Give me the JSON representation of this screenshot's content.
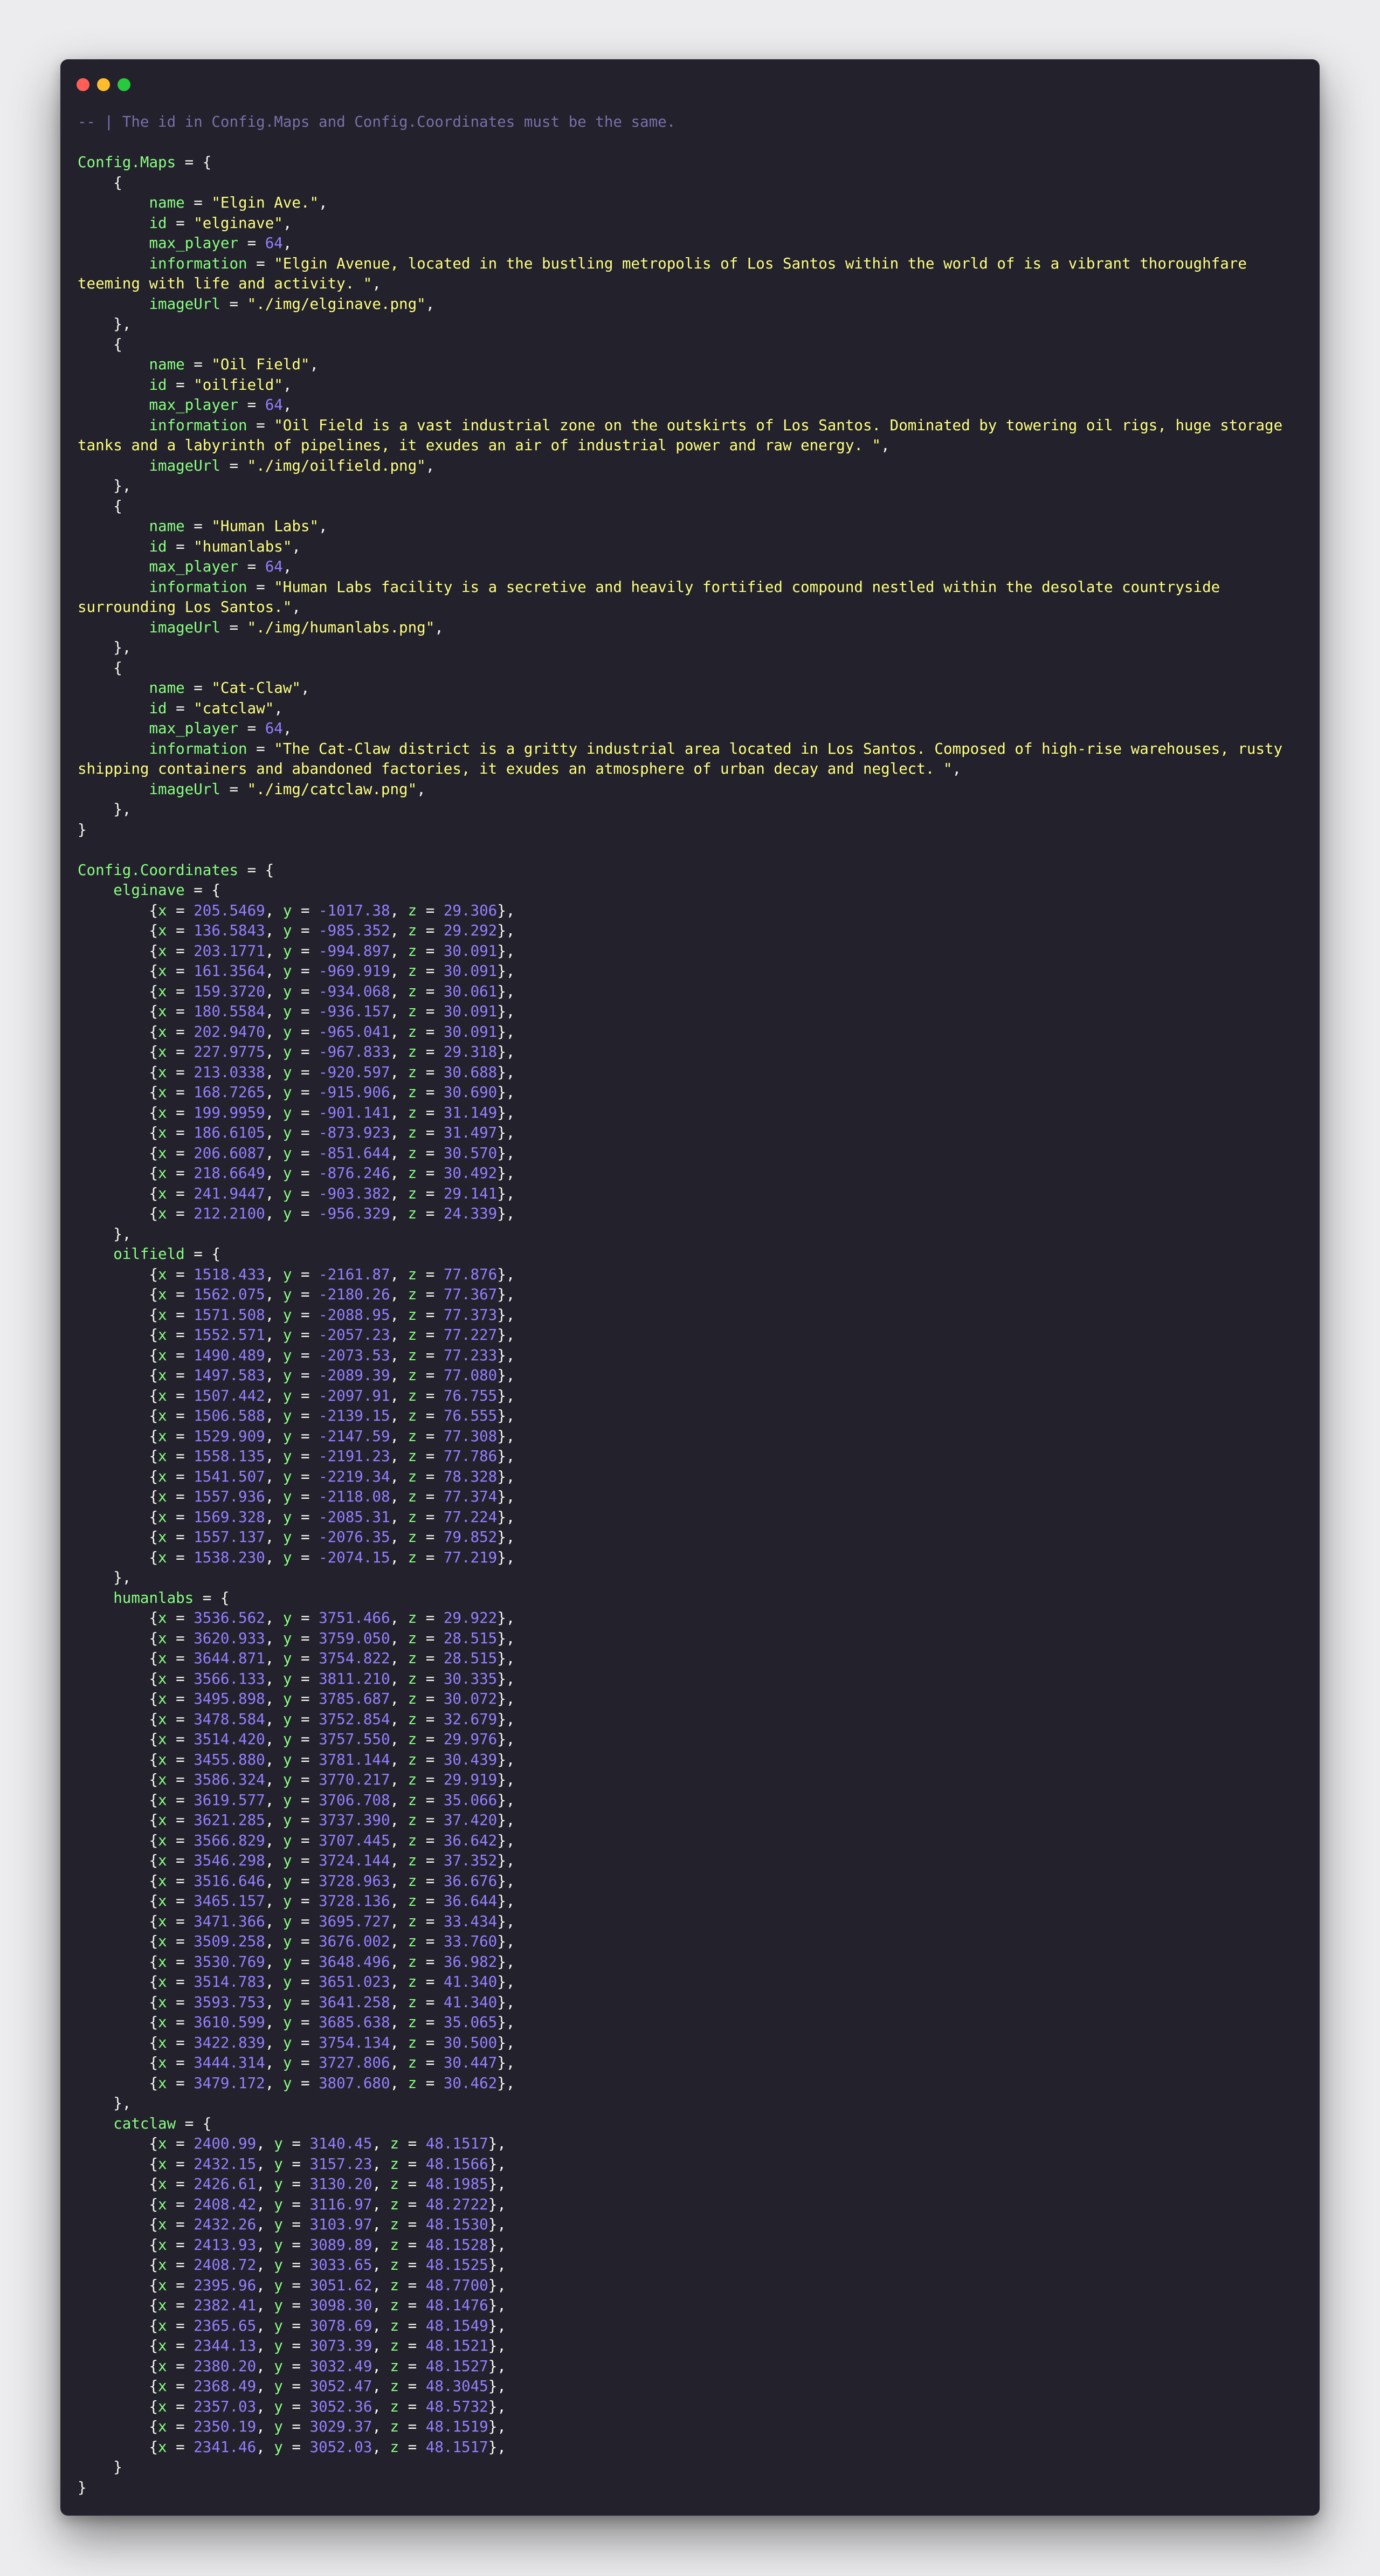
{
  "window": {
    "controls": {
      "close_color": "#ff5f56",
      "minimize_color": "#ffbd2e",
      "maximize_color": "#27c93f"
    }
  },
  "theme": {
    "background": "#22212c",
    "text": "#f8f8f2",
    "comment": "#7970a9",
    "identifier": "#8aff80",
    "string": "#ffff80",
    "number": "#9580ff"
  },
  "code": {
    "comment": "-- | The id in Config.Maps and Config.Coordinates must be the same.",
    "maps_var": "Config.Maps",
    "coords_var": "Config.Coordinates",
    "maps": [
      {
        "name": "\"Elgin Ave.\"",
        "id": "\"elginave\"",
        "max_player": "64",
        "information": "\"Elgin Avenue, located in the bustling metropolis of Los Santos within the world of is a vibrant thoroughfare teeming with life and activity. \"",
        "imageUrl": "\"./img/elginave.png\""
      },
      {
        "name": "\"Oil Field\"",
        "id": "\"oilfield\"",
        "max_player": "64",
        "information": "\"Oil Field is a vast industrial zone on the outskirts of Los Santos. Dominated by towering oil rigs, huge storage tanks and a labyrinth of pipelines, it exudes an air of industrial power and raw energy. \"",
        "imageUrl": "\"./img/oilfield.png\""
      },
      {
        "name": "\"Human Labs\"",
        "id": "\"humanlabs\"",
        "max_player": "64",
        "information": "\"Human Labs facility is a secretive and heavily fortified compound nestled within the desolate countryside surrounding Los Santos.\"",
        "imageUrl": "\"./img/humanlabs.png\""
      },
      {
        "name": "\"Cat-Claw\"",
        "id": "\"catclaw\"",
        "max_player": "64",
        "information": "\"The Cat-Claw district is a gritty industrial area located in Los Santos. Composed of high-rise warehouses, rusty shipping containers and abandoned factories, it exudes an atmosphere of urban decay and neglect. \"",
        "imageUrl": "\"./img/catclaw.png\""
      }
    ],
    "coordinates": [
      {
        "key": "elginave",
        "points": [
          [
            "205.5469",
            "-1017.38",
            "29.306"
          ],
          [
            "136.5843",
            "-985.352",
            "29.292"
          ],
          [
            "203.1771",
            "-994.897",
            "30.091"
          ],
          [
            "161.3564",
            "-969.919",
            "30.091"
          ],
          [
            "159.3720",
            "-934.068",
            "30.061"
          ],
          [
            "180.5584",
            "-936.157",
            "30.091"
          ],
          [
            "202.9470",
            "-965.041",
            "30.091"
          ],
          [
            "227.9775",
            "-967.833",
            "29.318"
          ],
          [
            "213.0338",
            "-920.597",
            "30.688"
          ],
          [
            "168.7265",
            "-915.906",
            "30.690"
          ],
          [
            "199.9959",
            "-901.141",
            "31.149"
          ],
          [
            "186.6105",
            "-873.923",
            "31.497"
          ],
          [
            "206.6087",
            "-851.644",
            "30.570"
          ],
          [
            "218.6649",
            "-876.246",
            "30.492"
          ],
          [
            "241.9447",
            "-903.382",
            "29.141"
          ],
          [
            "212.2100",
            "-956.329",
            "24.339"
          ]
        ]
      },
      {
        "key": "oilfield",
        "points": [
          [
            "1518.433",
            "-2161.87",
            "77.876"
          ],
          [
            "1562.075",
            "-2180.26",
            "77.367"
          ],
          [
            "1571.508",
            "-2088.95",
            "77.373"
          ],
          [
            "1552.571",
            "-2057.23",
            "77.227"
          ],
          [
            "1490.489",
            "-2073.53",
            "77.233"
          ],
          [
            "1497.583",
            "-2089.39",
            "77.080"
          ],
          [
            "1507.442",
            "-2097.91",
            "76.755"
          ],
          [
            "1506.588",
            "-2139.15",
            "76.555"
          ],
          [
            "1529.909",
            "-2147.59",
            "77.308"
          ],
          [
            "1558.135",
            "-2191.23",
            "77.786"
          ],
          [
            "1541.507",
            "-2219.34",
            "78.328"
          ],
          [
            "1557.936",
            "-2118.08",
            "77.374"
          ],
          [
            "1569.328",
            "-2085.31",
            "77.224"
          ],
          [
            "1557.137",
            "-2076.35",
            "79.852"
          ],
          [
            "1538.230",
            "-2074.15",
            "77.219"
          ]
        ]
      },
      {
        "key": "humanlabs",
        "points": [
          [
            "3536.562",
            "3751.466",
            "29.922"
          ],
          [
            "3620.933",
            "3759.050",
            "28.515"
          ],
          [
            "3644.871",
            "3754.822",
            "28.515"
          ],
          [
            "3566.133",
            "3811.210",
            "30.335"
          ],
          [
            "3495.898",
            "3785.687",
            "30.072"
          ],
          [
            "3478.584",
            "3752.854",
            "32.679"
          ],
          [
            "3514.420",
            "3757.550",
            "29.976"
          ],
          [
            "3455.880",
            "3781.144",
            "30.439"
          ],
          [
            "3586.324",
            "3770.217",
            "29.919"
          ],
          [
            "3619.577",
            "3706.708",
            "35.066"
          ],
          [
            "3621.285",
            "3737.390",
            "37.420"
          ],
          [
            "3566.829",
            "3707.445",
            "36.642"
          ],
          [
            "3546.298",
            "3724.144",
            "37.352"
          ],
          [
            "3516.646",
            "3728.963",
            "36.676"
          ],
          [
            "3465.157",
            "3728.136",
            "36.644"
          ],
          [
            "3471.366",
            "3695.727",
            "33.434"
          ],
          [
            "3509.258",
            "3676.002",
            "33.760"
          ],
          [
            "3530.769",
            "3648.496",
            "36.982"
          ],
          [
            "3514.783",
            "3651.023",
            "41.340"
          ],
          [
            "3593.753",
            "3641.258",
            "41.340"
          ],
          [
            "3610.599",
            "3685.638",
            "35.065"
          ],
          [
            "3422.839",
            "3754.134",
            "30.500"
          ],
          [
            "3444.314",
            "3727.806",
            "30.447"
          ],
          [
            "3479.172",
            "3807.680",
            "30.462"
          ]
        ]
      },
      {
        "key": "catclaw",
        "points": [
          [
            "2400.99",
            "3140.45",
            "48.1517"
          ],
          [
            "2432.15",
            "3157.23",
            "48.1566"
          ],
          [
            "2426.61",
            "3130.20",
            "48.1985"
          ],
          [
            "2408.42",
            "3116.97",
            "48.2722"
          ],
          [
            "2432.26",
            "3103.97",
            "48.1530"
          ],
          [
            "2413.93",
            "3089.89",
            "48.1528"
          ],
          [
            "2408.72",
            "3033.65",
            "48.1525"
          ],
          [
            "2395.96",
            "3051.62",
            "48.7700"
          ],
          [
            "2382.41",
            "3098.30",
            "48.1476"
          ],
          [
            "2365.65",
            "3078.69",
            "48.1549"
          ],
          [
            "2344.13",
            "3073.39",
            "48.1521"
          ],
          [
            "2380.20",
            "3032.49",
            "48.1527"
          ],
          [
            "2368.49",
            "3052.47",
            "48.3045"
          ],
          [
            "2357.03",
            "3052.36",
            "48.5732"
          ],
          [
            "2350.19",
            "3029.37",
            "48.1519"
          ],
          [
            "2341.46",
            "3052.03",
            "48.1517"
          ]
        ]
      }
    ]
  }
}
